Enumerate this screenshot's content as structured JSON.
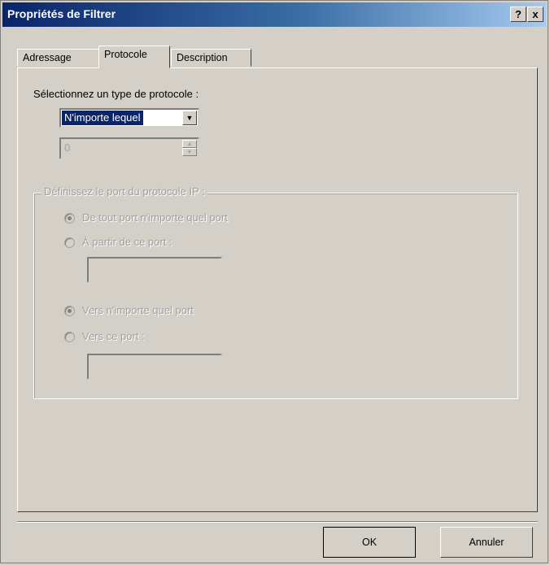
{
  "window": {
    "title": "Propriétés de Filtrer",
    "help_glyph": "?",
    "close_glyph": "x"
  },
  "tabs": [
    {
      "label": "Adressage"
    },
    {
      "label": "Protocole"
    },
    {
      "label": "Description"
    }
  ],
  "protocol": {
    "prompt": "Sélectionnez un type de protocole :",
    "selected": "N'importe lequel",
    "number_value": "0"
  },
  "ports": {
    "group_title": "Définissez le port du protocole IP :",
    "from_any": "De tout port n'importe quel port",
    "from_port": "À partir de ce port :",
    "to_any": "Vers n'importe quel port",
    "to_port": "Vers ce port :"
  },
  "buttons": {
    "ok": "OK",
    "cancel": "Annuler"
  }
}
